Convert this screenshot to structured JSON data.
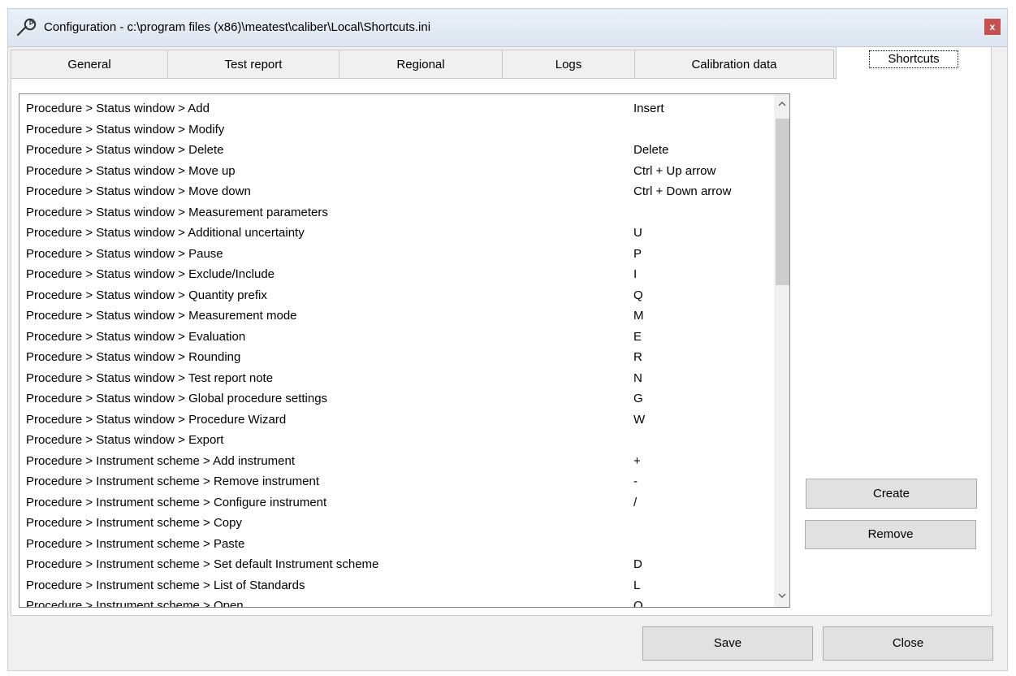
{
  "window": {
    "title": "Configuration - c:\\program files (x86)\\meatest\\caliber\\Local\\Shortcuts.ini",
    "close_glyph": "x",
    "icon": "wrench-icon"
  },
  "tabs": [
    {
      "label": "General",
      "active": false
    },
    {
      "label": "Test report",
      "active": false
    },
    {
      "label": "Regional",
      "active": false
    },
    {
      "label": "Logs",
      "active": false
    },
    {
      "label": "Calibration data",
      "active": false
    },
    {
      "label": "Shortcuts",
      "active": true
    }
  ],
  "shortcuts": [
    {
      "command": "Procedure > Status window > Add",
      "key": "Insert"
    },
    {
      "command": "Procedure > Status window > Modify",
      "key": ""
    },
    {
      "command": "Procedure > Status window > Delete",
      "key": "Delete"
    },
    {
      "command": "Procedure > Status window > Move up",
      "key": "Ctrl + Up arrow"
    },
    {
      "command": "Procedure > Status window > Move down",
      "key": "Ctrl + Down arrow"
    },
    {
      "command": "Procedure > Status window > Measurement parameters",
      "key": ""
    },
    {
      "command": "Procedure > Status window > Additional uncertainty",
      "key": "U"
    },
    {
      "command": "Procedure > Status window > Pause",
      "key": "P"
    },
    {
      "command": "Procedure > Status window > Exclude/Include",
      "key": "I"
    },
    {
      "command": "Procedure > Status window > Quantity prefix",
      "key": "Q"
    },
    {
      "command": "Procedure > Status window > Measurement mode",
      "key": "M"
    },
    {
      "command": "Procedure > Status window > Evaluation",
      "key": "E"
    },
    {
      "command": "Procedure > Status window > Rounding",
      "key": "R"
    },
    {
      "command": "Procedure > Status window > Test report note",
      "key": "N"
    },
    {
      "command": "Procedure > Status window > Global procedure settings",
      "key": "G"
    },
    {
      "command": "Procedure > Status window > Procedure Wizard",
      "key": "W"
    },
    {
      "command": "Procedure > Status window > Export",
      "key": ""
    },
    {
      "command": "Procedure > Instrument scheme > Add instrument",
      "key": "+"
    },
    {
      "command": "Procedure > Instrument scheme > Remove instrument",
      "key": "-"
    },
    {
      "command": "Procedure > Instrument scheme > Configure instrument",
      "key": "/"
    },
    {
      "command": "Procedure > Instrument scheme > Copy",
      "key": ""
    },
    {
      "command": "Procedure > Instrument scheme > Paste",
      "key": ""
    },
    {
      "command": "Procedure > Instrument scheme > Set default Instrument scheme",
      "key": "D"
    },
    {
      "command": "Procedure > Instrument scheme > List of Standards",
      "key": "L"
    },
    {
      "command": "Procedure > Instrument scheme > Open",
      "key": "O"
    }
  ],
  "scrollbar": {
    "up_glyph": "^",
    "down_glyph": "v",
    "position": 0.0
  },
  "buttons": {
    "create": "Create",
    "remove": "Remove",
    "save": "Save",
    "close": "Close"
  }
}
